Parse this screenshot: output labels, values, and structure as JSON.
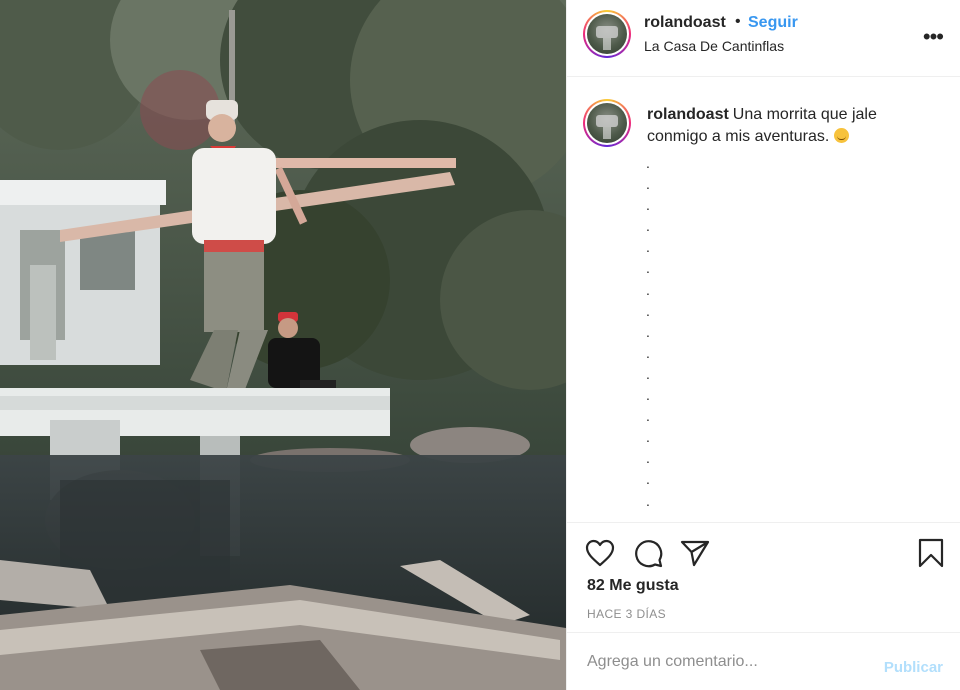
{
  "post": {
    "photo_icon": "photo",
    "username": "rolandoast",
    "follow_label": "Seguir",
    "separator": "•",
    "location": "La Casa De Cantinflas",
    "more_icon": "more-options-icon",
    "more_glyph": "•••"
  },
  "caption": {
    "username": "rolandoast",
    "text": "Una morrita que jale conmigo a mis aventuras.",
    "emoji": "smirk-emoji",
    "dots": [
      ".",
      ".",
      ".",
      ".",
      ".",
      ".",
      ".",
      ".",
      ".",
      ".",
      ".",
      ".",
      ".",
      ".",
      ".",
      ".",
      "."
    ]
  },
  "actions": {
    "icons": [
      "heart-icon",
      "comment-icon",
      "share-icon",
      "bookmark-icon"
    ],
    "likes": "82 Me gusta",
    "timestamp": "HACE 3 DÍAS"
  },
  "comment": {
    "placeholder": "Agrega un comentario...",
    "publish_label": "Publicar"
  },
  "colors": {
    "accent": "#3897f0",
    "publish_disabled": "#b2dffc",
    "muted": "#8e8e8e"
  }
}
